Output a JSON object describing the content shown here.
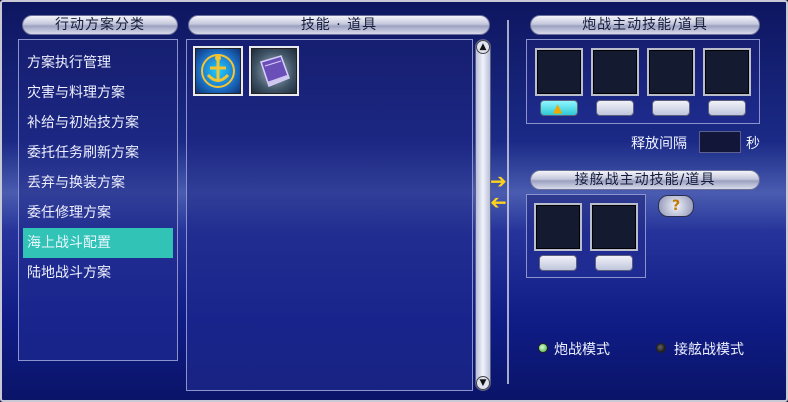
{
  "headers": {
    "categories": "行动方案分类",
    "skills": "技能 · 道具",
    "cannon": "炮战主动技能/道具",
    "boarding": "接舷战主动技能/道具"
  },
  "categories": [
    {
      "label": "方案执行管理",
      "active": false
    },
    {
      "label": "灾害与料理方案",
      "active": false
    },
    {
      "label": "补给与初始技方案",
      "active": false
    },
    {
      "label": "委托任务刷新方案",
      "active": false
    },
    {
      "label": "丢弃与换装方案",
      "active": false
    },
    {
      "label": "委任修理方案",
      "active": false
    },
    {
      "label": "海上战斗配置",
      "active": true
    },
    {
      "label": "陆地战斗方案",
      "active": false
    }
  ],
  "skill_items": [
    {
      "icon": "anchor-icon"
    },
    {
      "icon": "book-icon"
    }
  ],
  "cannon": {
    "interval_label": "释放间隔",
    "interval_unit": "秒",
    "interval_value": ""
  },
  "help_glyph": "?",
  "modes": {
    "cannon_mode": "炮战模式",
    "boarding_mode": "接舷战模式"
  },
  "colors": {
    "active_item": "#31c3b6",
    "arrow": "#ffd21b"
  }
}
